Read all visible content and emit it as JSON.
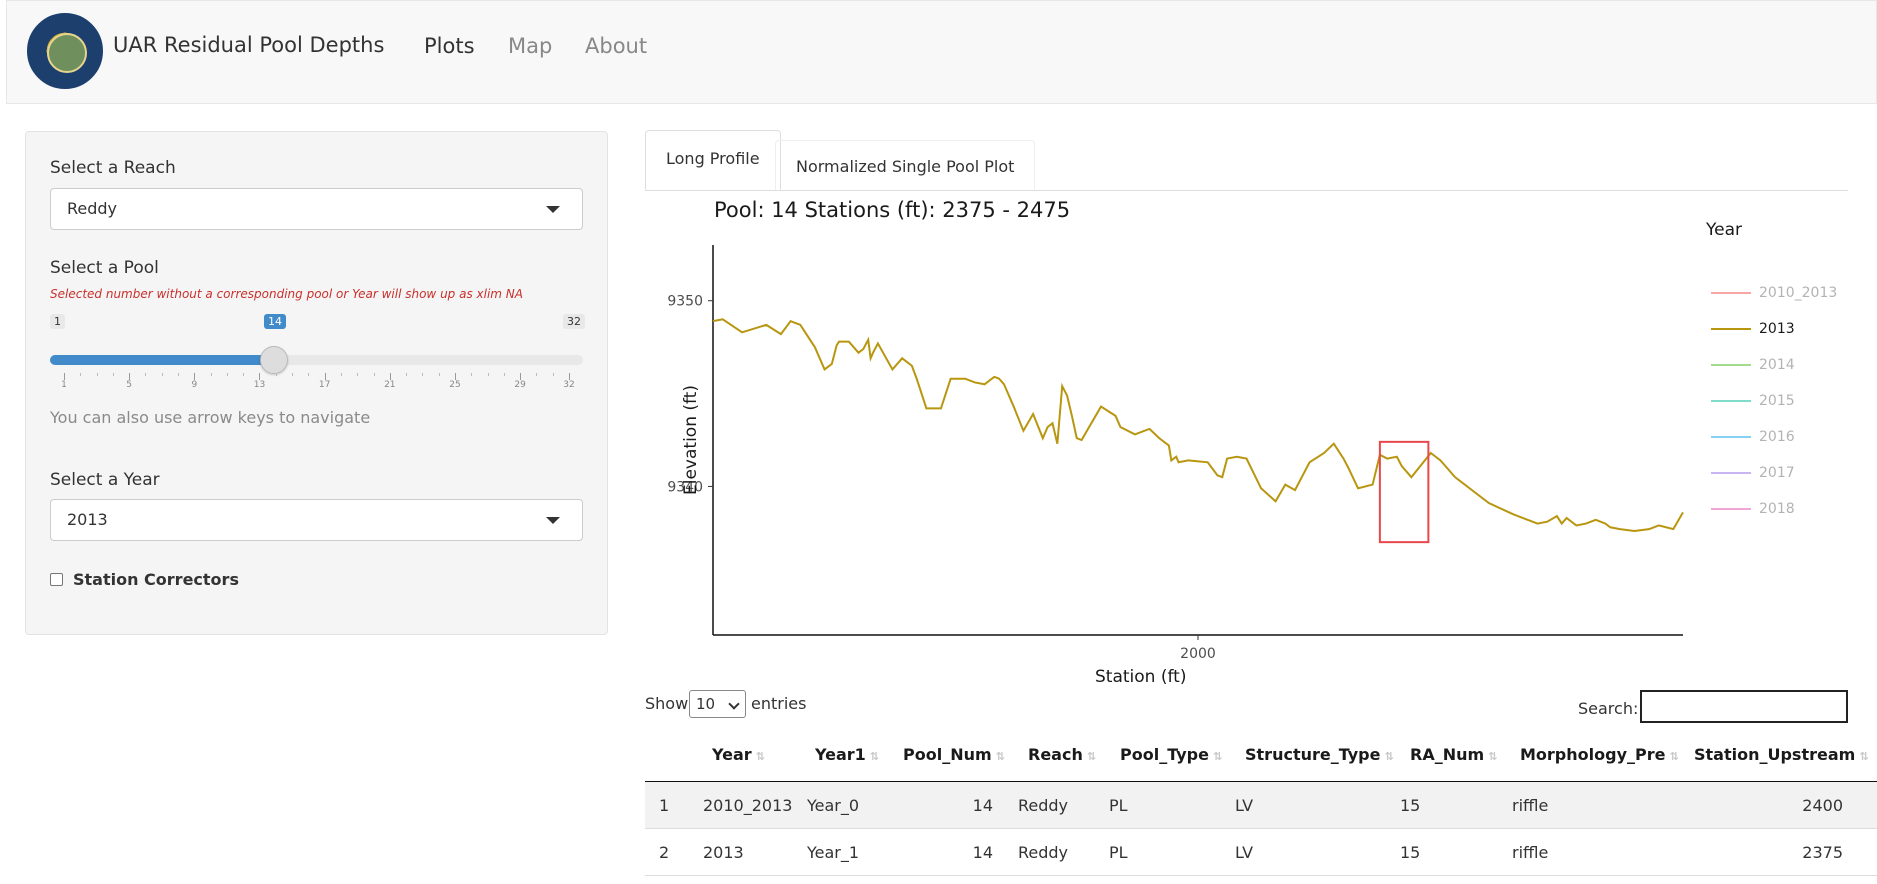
{
  "navbar": {
    "brand": "UAR Residual Pool Depths",
    "links": [
      "Plots",
      "Map",
      "About"
    ],
    "active": "Plots"
  },
  "sidebar": {
    "reach_label": "Select a Reach",
    "reach_value": "Reddy",
    "pool_label": "Select a Pool",
    "pool_warning": "Selected number without a corresponding pool or Year will show up as xlim NA",
    "pool_slider": {
      "min": "1",
      "max": "32",
      "value": "14",
      "ticks": [
        "1",
        "5",
        "9",
        "13",
        "17",
        "21",
        "25",
        "29",
        "32"
      ]
    },
    "pool_help": "You can also use arrow keys to navigate",
    "year_label": "Select a Year",
    "year_value": "2013",
    "station_correctors_label": "Station Correctors"
  },
  "tabs": [
    "Long Profile",
    "Normalized Single Pool Plot"
  ],
  "chart_data": {
    "type": "line",
    "title": "Pool: 14  Stations (ft):  2375 - 2475",
    "xlabel": "Station (ft)",
    "ylabel": "Elevation (ft)",
    "x_ticks": [
      2000
    ],
    "y_ticks": [
      9340,
      9350
    ],
    "xlim": [
      1000,
      3000
    ],
    "ylim": [
      9332,
      9353
    ],
    "legend_title": "Year",
    "legend_placement": "right",
    "series": [
      {
        "name": "2010_2013",
        "color": "#f8a5a5",
        "values": []
      },
      {
        "name": "2013",
        "color": "#b8960f",
        "x": [
          1000,
          1020,
          1060,
          1110,
          1140,
          1160,
          1180,
          1210,
          1230,
          1245,
          1255,
          1260,
          1280,
          1300,
          1310,
          1320,
          1325,
          1330,
          1340,
          1370,
          1390,
          1410,
          1420,
          1440,
          1470,
          1490,
          1520,
          1540,
          1560,
          1580,
          1590,
          1600,
          1620,
          1640,
          1660,
          1680,
          1690,
          1700,
          1710,
          1720,
          1730,
          1740,
          1750,
          1760,
          1800,
          1830,
          1840,
          1870,
          1900,
          1920,
          1940,
          1945,
          1955,
          1960,
          1980,
          2020,
          2040,
          2050,
          2060,
          2080,
          2100,
          2130,
          2160,
          2180,
          2200,
          2230,
          2260,
          2280,
          2300,
          2310,
          2330,
          2360,
          2375,
          2390,
          2410,
          2420,
          2440,
          2480,
          2500,
          2510,
          2530,
          2600,
          2650,
          2700,
          2720,
          2740,
          2750,
          2760,
          2780,
          2800,
          2820,
          2830,
          2840,
          2850,
          2870,
          2900,
          2930,
          2950,
          2980,
          3000
        ],
        "values": [
          9348.9,
          9349.0,
          9348.3,
          9348.7,
          9348.2,
          9348.9,
          9348.7,
          9347.5,
          9346.3,
          9346.6,
          9347.6,
          9347.8,
          9347.8,
          9347.2,
          9347.4,
          9347.9,
          9346.9,
          9347.2,
          9347.7,
          9346.3,
          9346.9,
          9346.5,
          9345.8,
          9344.2,
          9344.2,
          9345.8,
          9345.8,
          9345.6,
          9345.5,
          9345.9,
          9345.8,
          9345.5,
          9344.3,
          9343.0,
          9343.9,
          9342.6,
          9343.2,
          9343.4,
          9342.3,
          9345.4,
          9344.9,
          9343.8,
          9342.6,
          9342.5,
          9344.3,
          9343.8,
          9343.2,
          9342.8,
          9343.1,
          9342.6,
          9342.2,
          9341.4,
          9341.6,
          9341.3,
          9341.4,
          9341.3,
          9340.6,
          9340.5,
          9341.5,
          9341.6,
          9341.5,
          9339.9,
          9339.2,
          9340.1,
          9339.8,
          9341.3,
          9341.8,
          9342.3,
          9341.5,
          9341.0,
          9339.9,
          9340.1,
          9341.7,
          9341.5,
          9341.6,
          9341.1,
          9340.5,
          9341.8,
          9341.4,
          9341.1,
          9340.5,
          9339.1,
          9338.5,
          9338.0,
          9338.1,
          9338.4,
          9338.0,
          9338.3,
          9337.9,
          9338.0,
          9338.2,
          9338.1,
          9338.0,
          9337.8,
          9337.7,
          9337.6,
          9337.7,
          9337.9,
          9337.7,
          9338.6
        ]
      },
      {
        "name": "2014",
        "color": "#a3dc8f",
        "values": []
      },
      {
        "name": "2015",
        "color": "#7fdccb",
        "values": []
      },
      {
        "name": "2016",
        "color": "#86d0f2",
        "values": []
      },
      {
        "name": "2017",
        "color": "#c9b5f2",
        "values": []
      },
      {
        "name": "2018",
        "color": "#f2a6d7",
        "values": []
      }
    ],
    "highlight_box": {
      "x_range": [
        2375,
        2475
      ],
      "y_range": [
        9337.0,
        9342.4
      ],
      "color": "#e8474c"
    }
  },
  "table": {
    "show_label": "Show",
    "entries_value": "10",
    "entries_label": "entries",
    "search_label": "Search:",
    "columns": [
      "Year",
      "Year1",
      "Pool_Num",
      "Reach",
      "Pool_Type",
      "Structure_Type",
      "RA_Num",
      "Morphology_Pre",
      "Station_Upstream"
    ],
    "rows": [
      {
        "index": "1",
        "Year": "2010_2013",
        "Year1": "Year_0",
        "Pool_Num": "14",
        "Reach": "Reddy",
        "Pool_Type": "PL",
        "Structure_Type": "LV",
        "RA_Num": "15",
        "Morphology_Pre": "riffle",
        "Station_Upstream": "2400"
      },
      {
        "index": "2",
        "Year": "2013",
        "Year1": "Year_1",
        "Pool_Num": "14",
        "Reach": "Reddy",
        "Pool_Type": "PL",
        "Structure_Type": "LV",
        "RA_Num": "15",
        "Morphology_Pre": "riffle",
        "Station_Upstream": "2375"
      }
    ]
  }
}
